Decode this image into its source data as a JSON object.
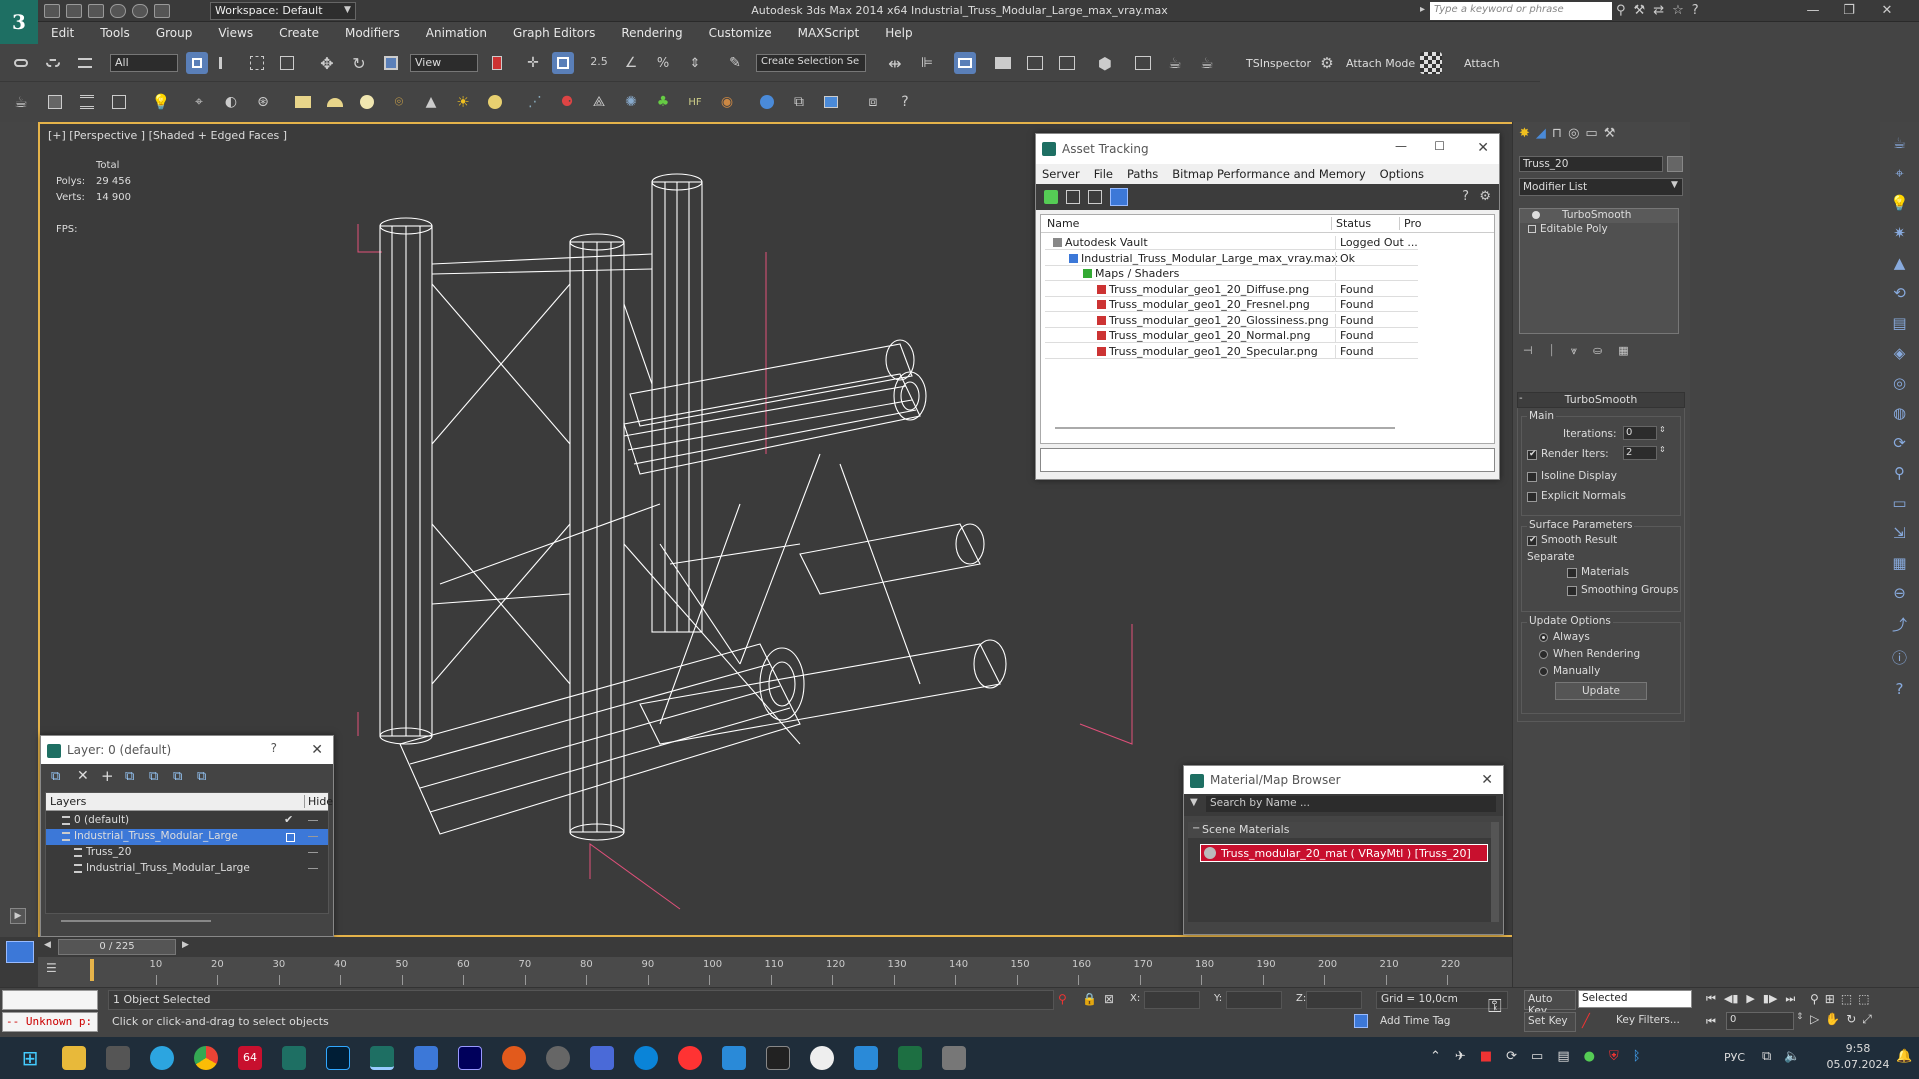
{
  "title_bar": {
    "workspace": "Workspace: Default",
    "app_title": "Autodesk 3ds Max  2014 x64     Industrial_Truss_Modular_Large_max_vray.max",
    "search_placeholder": "Type a keyword or phrase"
  },
  "menu": [
    "Edit",
    "Tools",
    "Group",
    "Views",
    "Create",
    "Modifiers",
    "Animation",
    "Graph Editors",
    "Rendering",
    "Customize",
    "MAXScript",
    "Help"
  ],
  "toolbar": {
    "filter_select": "All",
    "ref_coord_select": "View",
    "selection_set": "Create Selection Se",
    "ts_inspector": "TSInspector",
    "attach_mode": "Attach Mode",
    "attach": "Attach",
    "snap_value": "2.5"
  },
  "viewport": {
    "label": "[+] [Perspective ] [Shaded + Edged Faces ]",
    "stats_total": "Total",
    "polys_label": "Polys:",
    "polys_value": "29 456",
    "verts_label": "Verts:",
    "verts_value": "14 900",
    "fps_label": "FPS:"
  },
  "asset_tracking": {
    "title": "Asset Tracking",
    "menu": [
      "Server",
      "File",
      "Paths",
      "Bitmap Performance and Memory",
      "Options"
    ],
    "columns": [
      "Name",
      "Status",
      "Pro"
    ],
    "rows": [
      {
        "name": "Autodesk Vault",
        "status": "Logged Out ..."
      },
      {
        "name": "Industrial_Truss_Modular_Large_max_vray.max",
        "status": "Ok"
      },
      {
        "name": "Maps / Shaders",
        "status": ""
      },
      {
        "name": "Truss_modular_geo1_20_Diffuse.png",
        "status": "Found"
      },
      {
        "name": "Truss_modular_geo1_20_Fresnel.png",
        "status": "Found"
      },
      {
        "name": "Truss_modular_geo1_20_Glossiness.png",
        "status": "Found"
      },
      {
        "name": "Truss_modular_geo1_20_Normal.png",
        "status": "Found"
      },
      {
        "name": "Truss_modular_geo1_20_Specular.png",
        "status": "Found"
      }
    ]
  },
  "layer_dialog": {
    "title": "Layer: 0 (default)",
    "help": "?",
    "col_layers": "Layers",
    "col_hide": "Hide",
    "rows": [
      "0 (default)",
      "Industrial_Truss_Modular_Large",
      "Truss_20",
      "Industrial_Truss_Modular_Large"
    ]
  },
  "material_browser": {
    "title": "Material/Map Browser",
    "search_placeholder": "Search by Name ...",
    "section": "Scene Materials",
    "material": "Truss_modular_20_mat  ( VRayMtl )  [Truss_20]"
  },
  "command_panel": {
    "object_name": "Truss_20",
    "modifier_list": "Modifier List",
    "stack": [
      "TurboSmooth",
      "Editable Poly"
    ],
    "rollout_title": "TurboSmooth",
    "main_label": "Main",
    "iterations_label": "Iterations:",
    "iterations_value": "0",
    "render_iters_label": "Render Iters:",
    "render_iters_value": "2",
    "isoline": "Isoline Display",
    "explicit_normals": "Explicit Normals",
    "surface_params": "Surface Parameters",
    "smooth_result": "Smooth Result",
    "separate": "Separate",
    "materials": "Materials",
    "smoothing_groups": "Smoothing Groups",
    "update_options": "Update Options",
    "always": "Always",
    "when_rendering": "When Rendering",
    "manually": "Manually",
    "update_button": "Update"
  },
  "timeline": {
    "frame": "0 / 225",
    "ticks": [
      "10",
      "20",
      "30",
      "40",
      "50",
      "60",
      "70",
      "80",
      "90",
      "100",
      "110",
      "120",
      "130",
      "140",
      "150",
      "160",
      "170",
      "180",
      "190",
      "200",
      "210",
      "220"
    ]
  },
  "status": {
    "maxscript": "-- Unknown p:",
    "selected": "1 Object Selected",
    "prompt": "Click or click-and-drag to select objects",
    "x_label": "X:",
    "y_label": "Y:",
    "z_label": "Z:",
    "grid": "Grid = 10,0cm",
    "add_time_tag": "Add Time Tag",
    "auto_key": "Auto Key",
    "set_key": "Set Key",
    "key_select": "Selected",
    "key_filters": "Key Filters...",
    "frame_value": "0"
  },
  "taskbar": {
    "lang": "РУС",
    "time": "9:58",
    "date": "05.07.2024",
    "badge": "64"
  },
  "colors": {
    "accent": "#e5b34a",
    "viewport_bg": "#3b3b3b",
    "wire": "#ffffff",
    "selection": "#3c78d8",
    "material_swatch": "#c8102e"
  }
}
